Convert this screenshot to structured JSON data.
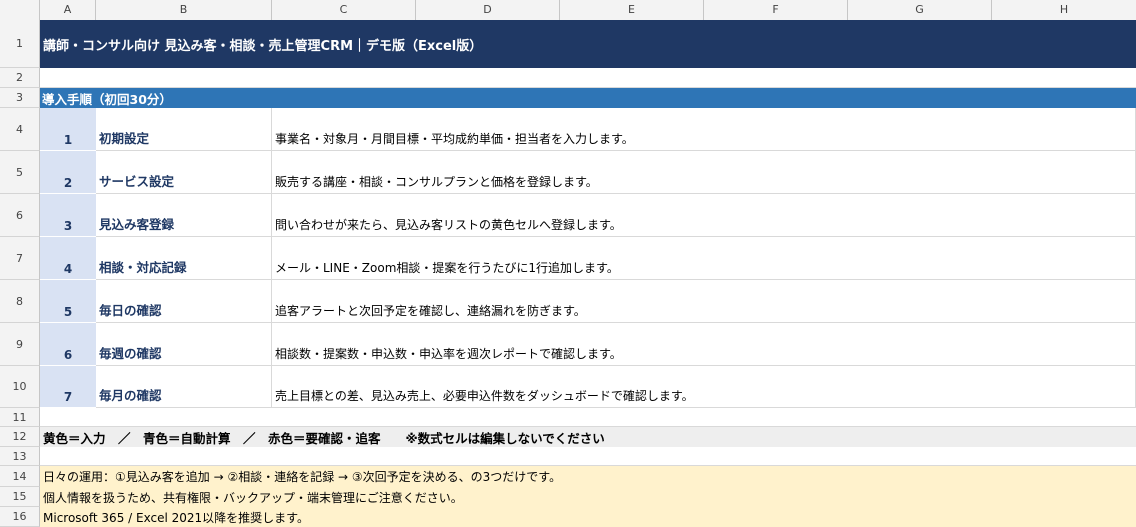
{
  "columns": [
    "A",
    "B",
    "C",
    "D",
    "E",
    "F",
    "G",
    "H"
  ],
  "rows": [
    "1",
    "2",
    "3",
    "4",
    "5",
    "6",
    "7",
    "8",
    "9",
    "10",
    "11",
    "12",
    "13",
    "14",
    "15",
    "16"
  ],
  "title": "講師・コンサル向け 見込み客・相談・売上管理CRM｜デモ版（Excel版）",
  "section_heading": "導入手順（初回30分）",
  "steps": [
    {
      "num": "1",
      "title": "初期設定",
      "desc": "事業名・対象月・月間目標・平均成約単価・担当者を入力します。"
    },
    {
      "num": "2",
      "title": "サービス設定",
      "desc": "販売する講座・相談・コンサルプランと価格を登録します。"
    },
    {
      "num": "3",
      "title": "見込み客登録",
      "desc": "問い合わせが来たら、見込み客リストの黄色セルへ登録します。"
    },
    {
      "num": "4",
      "title": "相談・対応記録",
      "desc": "メール・LINE・Zoom相談・提案を行うたびに1行追加します。"
    },
    {
      "num": "5",
      "title": "毎日の確認",
      "desc": "追客アラートと次回予定を確認し、連絡漏れを防ぎます。"
    },
    {
      "num": "6",
      "title": "毎週の確認",
      "desc": "相談数・提案数・申込数・申込率を週次レポートで確認します。"
    },
    {
      "num": "7",
      "title": "毎月の確認",
      "desc": "売上目標との差、見込み売上、必要申込件数をダッシュボードで確認します。"
    }
  ],
  "legend": "黄色＝入力　／　青色＝自動計算　／　赤色＝要確認・追客　　※数式セルは編集しないでください",
  "notes": [
    "日々の運用：①見込み客を追加 → ②相談・連絡を記録 → ③次回予定を決める、の3つだけです。",
    "個人情報を扱うため、共有権限・バックアップ・端末管理にご注意ください。",
    "Microsoft 365 / Excel 2021以降を推奨します。"
  ]
}
